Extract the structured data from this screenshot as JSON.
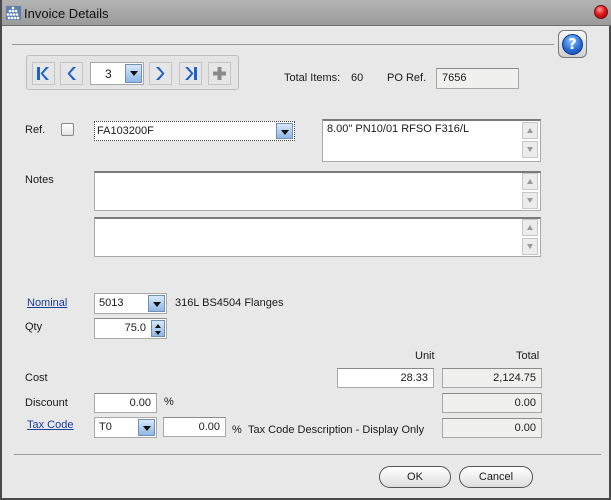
{
  "window": {
    "title": "Invoice Details",
    "help_label": "?"
  },
  "navigator": {
    "current_item": "3",
    "buttons": [
      "first-record",
      "previous-record",
      "next-record",
      "last-record",
      "add-record"
    ]
  },
  "summary": {
    "total_items_label": "Total Items:",
    "total_items_value": "60",
    "po_ref_label": "PO Ref.",
    "po_ref_value": "7656"
  },
  "ref": {
    "label": "Ref.",
    "checked": false,
    "code": "FA103200F",
    "description": "8.00\" PN10/01 RFSO F316/L"
  },
  "notes": {
    "label": "Notes",
    "note1": "",
    "note2": ""
  },
  "nominal": {
    "label": "Nominal",
    "code": "5013",
    "description": "316L BS4504 Flanges"
  },
  "qty": {
    "label": "Qty",
    "value": "75.0"
  },
  "pricing": {
    "unit_header": "Unit",
    "total_header": "Total",
    "cost_label": "Cost",
    "cost_unit": "28.33",
    "cost_total": "2,124.75",
    "discount_label": "Discount",
    "discount_percent": "0.00",
    "discount_percent_symbol": "%",
    "discount_total": "0.00",
    "tax_code_label": "Tax Code",
    "tax_code": "T0",
    "tax_rate": "0.00",
    "tax_percent_symbol": "%",
    "tax_description": "Tax Code Description - Display Only",
    "tax_total": "0.00"
  },
  "footer": {
    "ok_label": "OK",
    "cancel_label": "Cancel"
  }
}
